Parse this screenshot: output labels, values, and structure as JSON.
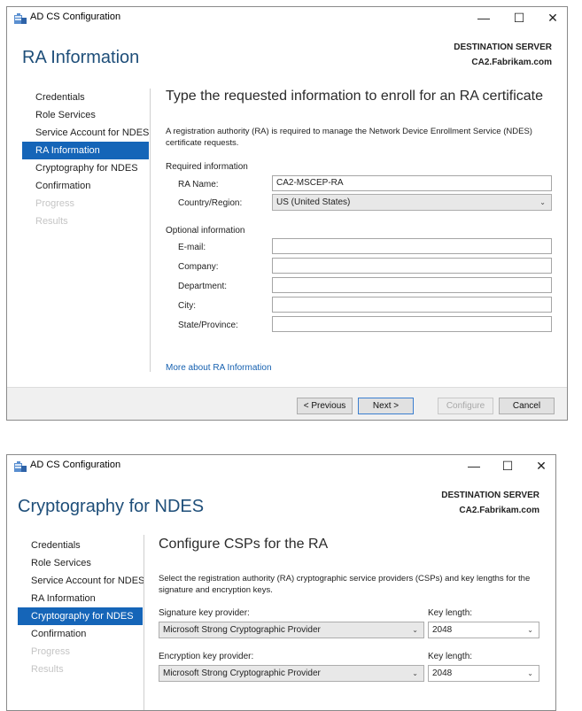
{
  "window1": {
    "app_title": "AD CS Configuration",
    "controls": {
      "minimize": "—",
      "maximize": "☐",
      "close": "✕"
    },
    "header_title": "RA Information",
    "destination_label": "DESTINATION SERVER",
    "destination_server": "CA2.Fabrikam.com",
    "nav": [
      {
        "label": "Credentials"
      },
      {
        "label": "Role Services"
      },
      {
        "label": "Service Account for NDES"
      },
      {
        "label": "RA Information"
      },
      {
        "label": "Cryptography for NDES"
      },
      {
        "label": "Confirmation"
      },
      {
        "label": "Progress"
      },
      {
        "label": "Results"
      }
    ],
    "content_title": "Type the requested information to enroll for an RA certificate",
    "description": "A registration authority (RA) is required to manage the Network Device Enrollment Service (NDES) certificate requests.",
    "required_section": "Required information",
    "ra_name_label": "RA Name:",
    "ra_name_value": "CA2-MSCEP-RA",
    "country_label": "Country/Region:",
    "country_value": "US (United States)",
    "optional_section": "Optional information",
    "optional_fields": [
      {
        "label": "E-mail:",
        "value": ""
      },
      {
        "label": "Company:",
        "value": ""
      },
      {
        "label": "Department:",
        "value": ""
      },
      {
        "label": "City:",
        "value": ""
      },
      {
        "label": "State/Province:",
        "value": ""
      }
    ],
    "more_link": "More about RA Information",
    "buttons": {
      "previous": "< Previous",
      "next": "Next >",
      "configure": "Configure",
      "cancel": "Cancel"
    }
  },
  "window2": {
    "app_title": "AD CS Configuration",
    "controls": {
      "minimize": "—",
      "maximize": "☐",
      "close": "✕"
    },
    "header_title": "Cryptography for NDES",
    "destination_label": "DESTINATION SERVER",
    "destination_server": "CA2.Fabrikam.com",
    "nav": [
      {
        "label": "Credentials"
      },
      {
        "label": "Role Services"
      },
      {
        "label": "Service Account for NDES"
      },
      {
        "label": "RA Information"
      },
      {
        "label": "Cryptography for NDES"
      },
      {
        "label": "Confirmation"
      },
      {
        "label": "Progress"
      },
      {
        "label": "Results"
      }
    ],
    "content_title": "Configure CSPs for the RA",
    "description": "Select the registration authority (RA) cryptographic service providers (CSPs) and key lengths for the signature and encryption keys.",
    "signature_label": "Signature key provider:",
    "signature_value": "Microsoft Strong Cryptographic Provider",
    "signature_key_label": "Key length:",
    "signature_key_value": "2048",
    "encryption_label": "Encryption key provider:",
    "encryption_value": "Microsoft Strong Cryptographic Provider",
    "encryption_key_label": "Key length:",
    "encryption_key_value": "2048"
  },
  "icons": {
    "app": "server-manager-icon",
    "dropdown": "chevron-down-icon"
  },
  "colors": {
    "accent": "#1565b8",
    "header_text": "#1e4e79",
    "link": "#1560b0",
    "disabled_text": "#c5c5c5"
  }
}
